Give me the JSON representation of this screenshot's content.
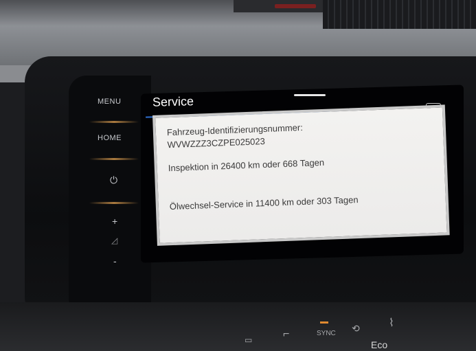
{
  "side_buttons": {
    "menu": "MENU",
    "home": "HOME",
    "power_icon": "power-icon",
    "plus": "+",
    "volume_icon": "volume-icon",
    "minus": "-"
  },
  "screen": {
    "title": "Service",
    "back_icon": "back-icon",
    "dialog": {
      "vin_label": "Fahrzeug-Identifizierungsnummer:",
      "vin_value": "WVWZZZ3CZPE025023",
      "inspection": "Inspektion in 26400 km oder 668 Tagen",
      "oil_service": "Ölwechsel-Service in 11400 km oder 303 Tagen"
    }
  },
  "climate": {
    "sync": "SYNC",
    "eco": "Eco"
  },
  "colors": {
    "accent_line": "#2f6fd0",
    "screen_bg": "#020204",
    "dialog_bg": "#f0efed",
    "sync_lamp": "#e08a30"
  }
}
